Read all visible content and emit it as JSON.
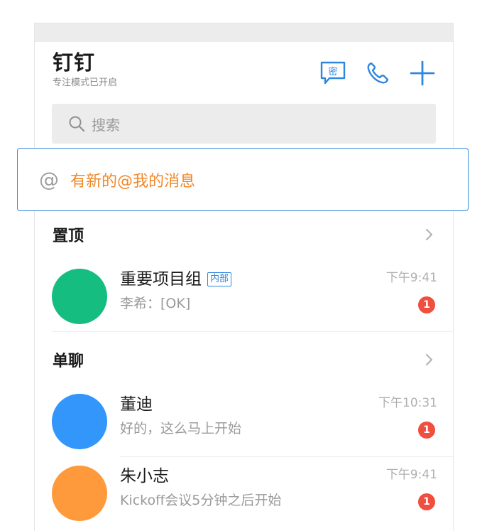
{
  "app": {
    "title": "钉钉",
    "subtitle": "专注模式已开启"
  },
  "header_icons": {
    "secret_chat": "secret-chat-icon",
    "secret_chat_label": "密",
    "phone": "phone-icon",
    "add": "plus-icon"
  },
  "search": {
    "placeholder": "搜索",
    "icon": "search-icon"
  },
  "at_banner": {
    "symbol": "@",
    "text": "有新的@我的消息",
    "text_color": "#f0892a",
    "border_color": "#3a8ddb"
  },
  "sections": {
    "pinned": {
      "title": "置顶",
      "items": [
        {
          "name": "重要项目组",
          "tag": "内部",
          "preview": "李希：[OK]",
          "time": "下午9:41",
          "unread": "1",
          "avatar_color": "#16bd81"
        }
      ]
    },
    "direct": {
      "title": "单聊",
      "items": [
        {
          "name": "董迪",
          "preview": "好的，这么马上开始",
          "time": "下午10:31",
          "unread": "1",
          "avatar_color": "#3296fa"
        },
        {
          "name": "朱小志",
          "preview": "Kickoff会议5分钟之后开始",
          "time": "下午9:41",
          "unread": "1",
          "avatar_color": "#ff9a3c"
        }
      ]
    }
  },
  "colors": {
    "accent": "#2e86de",
    "badge": "#f04e3e",
    "search_bg": "#ececec"
  }
}
